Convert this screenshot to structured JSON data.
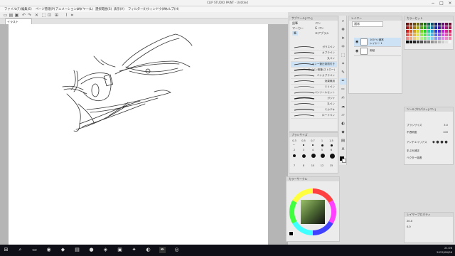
{
  "titlebar": {
    "title": "CLIP STUDIO PAINT - Untitled"
  },
  "menu": [
    "ファイル(F)",
    "編集(E)",
    "ページ管理(P)",
    "アニメーション(A)",
    "レイヤー(L)",
    "選択範囲(S)",
    "表示(V)",
    "フィルター(I)",
    "ウィンドウ(W)",
    "ヘルプ(H)"
  ],
  "tab": {
    "label": "イラスト"
  },
  "subtool": {
    "header": "サブツール[ペン]",
    "buttons": [
      "鉛筆",
      "ペン",
      "マーカー",
      "G ペン",
      "筆",
      "エアブラシ"
    ],
    "brushes": [
      "ガラスペン",
      "カブラペン",
      "丸ペン",
      "ペンー筆圧制限付き",
      "ペン/ペン鉛筆(ストロー)",
      "ベンカブラペン",
      "効果線用",
      "ミリペン",
      "ペンツールセット",
      "ガジャ",
      "丸ペン",
      "ミカヅキ",
      "ロードペン"
    ]
  },
  "brushsize": {
    "header": "ブラシサイズ",
    "sizes": [
      "0.3",
      "0.5",
      "0.7",
      "1",
      "1.5",
      "2",
      "3",
      "4",
      "5",
      "6",
      "7",
      "8",
      "10",
      "12",
      "15"
    ]
  },
  "colorwheel": {
    "header": "カラーサークル"
  },
  "layers": {
    "header": "レイヤー",
    "blend": "通常",
    "items": [
      {
        "name": "100 % 通常",
        "sub": "レイヤー 1"
      },
      {
        "name": "用紙",
        "sub": ""
      }
    ]
  },
  "colorset": {
    "header": "カラーセット"
  },
  "toolprops": {
    "header": "ツールプロパティ[ペン]",
    "rows": [
      {
        "label": "ブラシサイズ",
        "value": "3.0"
      },
      {
        "label": "不透明度",
        "value": "100"
      },
      {
        "label": "アンチエイリアス",
        "value": ""
      },
      {
        "label": "手ぶれ補正",
        "value": ""
      },
      {
        "label": "ベクター吸着",
        "value": ""
      }
    ]
  },
  "navigator": {
    "header": "レイヤープロパティ",
    "zoom": "20.0",
    "angle": "0.0"
  },
  "taskbar": {
    "time": "21:06",
    "date": "2022/06/06"
  },
  "colors": {
    "accent": "#1e88e5",
    "fg": "#000000",
    "bg": "#ffffff"
  }
}
